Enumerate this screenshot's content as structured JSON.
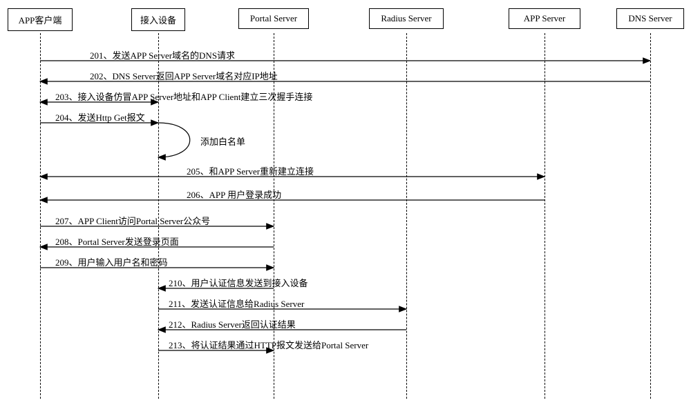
{
  "participants": {
    "p1": "APP客户端",
    "p2": "接入设备",
    "p3": "Portal Server",
    "p4": "Radius Server",
    "p5": "APP Server",
    "p6": "DNS Server"
  },
  "messages": {
    "m201": "201、发送APP Server域名的DNS请求",
    "m202": "202、DNS Server返回APP Server域名对应IP地址",
    "m203": "203、接入设备仿冒APP Server地址和APP Client建立三次握手连接",
    "m204": "204、发送Http Get报文",
    "note_whitelist": "添加白名单",
    "m205": "205、和APP Server重新建立连接",
    "m206": "206、APP 用户登录成功",
    "m207": "207、APP Client访问Portal Server公众号",
    "m208": "208、Portal Server发送登录页面",
    "m209": "209、用户输入用户名和密码",
    "m210": "210、用户认证信息发送到接入设备",
    "m211": "211、发送认证信息给Radius Server",
    "m212": "212、Radius Server返回认证结果",
    "m213": "213、将认证结果通过HTTP报文发送给Portal Server"
  },
  "chart_data": {
    "type": "table",
    "description": "UML sequence diagram of APP client authentication flow via access device, Portal Server, Radius Server, APP Server and DNS Server",
    "participants": [
      "APP客户端",
      "接入设备",
      "Portal Server",
      "Radius Server",
      "APP Server",
      "DNS Server"
    ],
    "steps": [
      {
        "no": 201,
        "from": "APP客户端",
        "to": "DNS Server",
        "text": "发送APP Server域名的DNS请求"
      },
      {
        "no": 202,
        "from": "DNS Server",
        "to": "APP客户端",
        "text": "DNS Server返回APP Server域名对应IP地址"
      },
      {
        "no": 203,
        "from": "APP客户端",
        "to": "接入设备",
        "text": "接入设备仿冒APP Server地址和APP Client建立三次握手连接",
        "bidirectional": true
      },
      {
        "no": 204,
        "from": "APP客户端",
        "to": "接入设备",
        "text": "发送Http Get报文",
        "self_note": "添加白名单"
      },
      {
        "no": 205,
        "from": "APP客户端",
        "to": "APP Server",
        "text": "和APP Server重新建立连接",
        "bidirectional": true
      },
      {
        "no": 206,
        "from": "APP Server",
        "to": "APP客户端",
        "text": "APP 用户登录成功"
      },
      {
        "no": 207,
        "from": "APP客户端",
        "to": "Portal Server",
        "text": "APP Client访问Portal Server公众号"
      },
      {
        "no": 208,
        "from": "Portal Server",
        "to": "APP客户端",
        "text": "Portal Server发送登录页面"
      },
      {
        "no": 209,
        "from": "APP客户端",
        "to": "Portal Server",
        "text": "用户输入用户名和密码"
      },
      {
        "no": 210,
        "from": "Portal Server",
        "to": "接入设备",
        "text": "用户认证信息发送到接入设备"
      },
      {
        "no": 211,
        "from": "接入设备",
        "to": "Radius Server",
        "text": "发送认证信息给Radius Server"
      },
      {
        "no": 212,
        "from": "Radius Server",
        "to": "接入设备",
        "text": "Radius Server返回认证结果"
      },
      {
        "no": 213,
        "from": "接入设备",
        "to": "Portal Server",
        "text": "将认证结果通过HTTP报文发送给Portal Server"
      }
    ]
  }
}
